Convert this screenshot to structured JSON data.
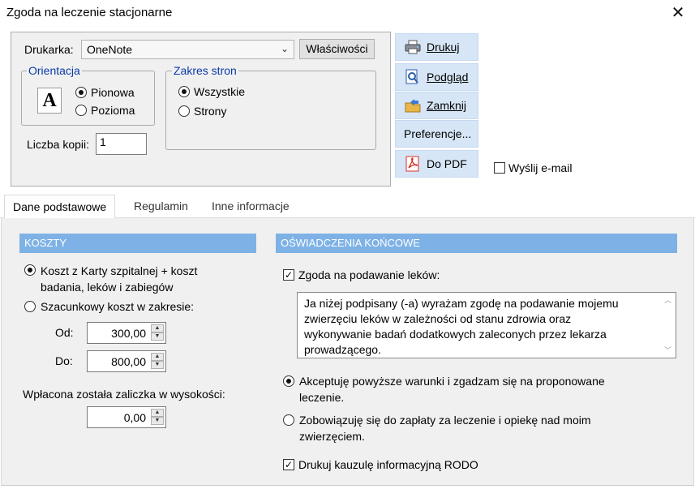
{
  "window": {
    "title": "Zgoda na leczenie stacjonarne",
    "close_glyph": "✕"
  },
  "printer": {
    "label": "Drukarka:",
    "selected": "OneNote",
    "properties_button": "Właściwości"
  },
  "orientation": {
    "title": "Orientacja",
    "icon_letter": "A",
    "options": [
      "Pionowa",
      "Pozioma"
    ],
    "selected": "Pionowa"
  },
  "range": {
    "title": "Zakres stron",
    "options": [
      "Wszystkie",
      "Strony"
    ],
    "selected": "Wszystkie"
  },
  "copies": {
    "label": "Liczba kopii:",
    "value": "1"
  },
  "actions": {
    "print": "Drukuj",
    "preview": "Podgląd",
    "close": "Zamknij",
    "preferences": "Preferencje...",
    "pdf": "Do PDF"
  },
  "send_email": {
    "label": "Wyślij e-mail",
    "checked": false
  },
  "tabs": [
    "Dane podstawowe",
    "Regulamin",
    "Inne informacje"
  ],
  "active_tab": "Dane podstawowe",
  "costs": {
    "header": "KOSZTY",
    "option1_line1": "Koszt z Karty szpitalnej + koszt",
    "option1_line2": "badania, leków i zabiegów",
    "option2": "Szacunkowy koszt w zakresie:",
    "selected": "option1",
    "from_label": "Od:",
    "from_value": "300,00",
    "to_label": "Do:",
    "to_value": "800,00",
    "deposit_label": "Wpłacona została zaliczka w wysokości:",
    "deposit_value": "0,00"
  },
  "statements": {
    "header": "OŚWIADCZENIA KOŃCOWE",
    "consent_label": "Zgoda na podawanie leków:",
    "consent_checked": true,
    "memo_lines": [
      "Ja niżej podpisany (-a) wyrażam zgodę na podawanie mojemu",
      "zwierzęciu leków w zależności od stanu zdrowia oraz",
      "wykonywanie badań dodatkowych zaleconych przez lekarza",
      "prowadzącego."
    ],
    "accept_line1": "Akceptuję powyższe warunki i zgadzam się na proponowane",
    "accept_line2": "leczenie.",
    "commit_line1": "Zobowiązuję się do zapłaty za leczenie i opiekę nad moim",
    "commit_line2": "zwierzęciem.",
    "selected": "accept",
    "rodo_label": "Drukuj kauzulę informacyjną RODO",
    "rodo_checked": true
  },
  "colors": {
    "section_header": "#7eb2e6",
    "action_button": "#d7e6f6",
    "group_title": "#0a3aa8",
    "pdf_icon": "#d9302a"
  },
  "icons": {
    "print": "printer-icon",
    "preview": "magnifier-icon",
    "close": "folder-arrow-icon",
    "pdf": "pdf-icon"
  }
}
